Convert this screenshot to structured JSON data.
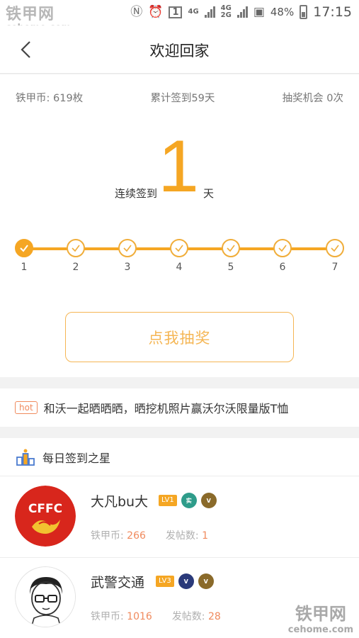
{
  "status_bar": {
    "time": "17:15",
    "battery": "48%",
    "network_1": "4G",
    "network_2": "4G",
    "network_3": "2G",
    "sim_slot": "1",
    "nfc_icon": "nfc-icon",
    "alarm_icon": "alarm-icon"
  },
  "watermark": {
    "title": "铁甲网",
    "url": "cehome.com"
  },
  "header": {
    "title": "欢迎回家"
  },
  "stats": {
    "coins": "铁甲币: 619枚",
    "total_signins": "累计签到59天",
    "lottery_chances": "抽奖机会 0次"
  },
  "streak": {
    "label": "连续签到",
    "days": "1",
    "unit": "天"
  },
  "progress": {
    "days": [
      "1",
      "2",
      "3",
      "4",
      "5",
      "6",
      "7"
    ],
    "completed": 1,
    "accent_color": "#f5a623"
  },
  "lottery_button": {
    "label": "点我抽奖"
  },
  "announcement": {
    "badge": "hot",
    "text": "和沃一起晒晒晒，晒挖机照片赢沃尔沃限量版T恤"
  },
  "daily_stars": {
    "title": "每日签到之星",
    "users": [
      {
        "name": "大凡bu大",
        "level": "LV1",
        "coins_label": "铁甲币:",
        "coins": "266",
        "posts_label": "发帖数:",
        "posts": "1",
        "avatar_text": "CFFC"
      },
      {
        "name": "武警交通",
        "level": "LV3",
        "coins_label": "铁甲币:",
        "coins": "1016",
        "posts_label": "发帖数:",
        "posts": "28"
      }
    ]
  }
}
